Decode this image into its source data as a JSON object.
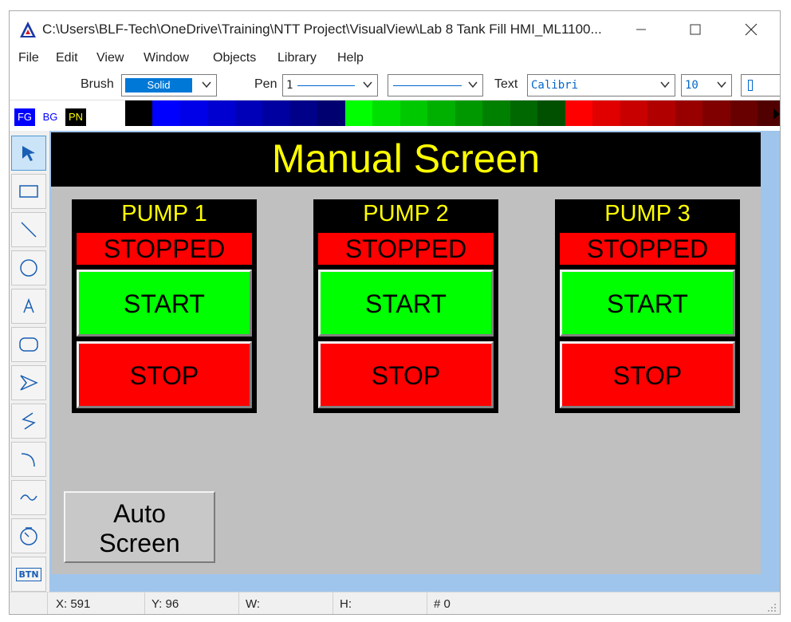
{
  "window": {
    "title": "C:\\Users\\BLF-Tech\\OneDrive\\Training\\NTT Project\\VisualView\\Lab 8 Tank Fill HMI_ML1100...",
    "minimize_icon": "minimize-icon",
    "maximize_icon": "maximize-icon",
    "close_icon": "close-icon"
  },
  "menu": [
    "File",
    "Edit",
    "View",
    "Window",
    "Objects",
    "Library",
    "Help"
  ],
  "toolbar": {
    "brush_label": "Brush",
    "brush_value": "Solid",
    "pen_label": "Pen",
    "pen_value": "1",
    "text_label": "Text",
    "font_value": "Calibri",
    "size_value": "10"
  },
  "palette": {
    "fg": "FG",
    "bg": "BG",
    "pn": "PN",
    "colors": [
      "#ffffff",
      "#000000",
      "#0000ff",
      "#0000e8",
      "#0000d0",
      "#0000b8",
      "#0000a0",
      "#000088",
      "#000070",
      "#00ff00",
      "#00e000",
      "#00c800",
      "#00b000",
      "#009800",
      "#008000",
      "#006800",
      "#005000",
      "#ff0000",
      "#e00000",
      "#c80000",
      "#b00000",
      "#980000",
      "#800000",
      "#680000",
      "#500000"
    ]
  },
  "tools": [
    "pointer-icon",
    "rectangle-icon",
    "line-icon",
    "circle-icon",
    "text-tool-icon",
    "rounded-rect-icon",
    "polygon-icon",
    "polyline-icon",
    "arc-icon",
    "wave-icon",
    "gauge-icon",
    "button-tool-icon"
  ],
  "tool_btn_label": "BTN",
  "screen": {
    "title": "Manual Screen",
    "pumps": [
      {
        "name": "PUMP 1",
        "status": "STOPPED",
        "start": "START",
        "stop": "STOP"
      },
      {
        "name": "PUMP 2",
        "status": "STOPPED",
        "start": "START",
        "stop": "STOP"
      },
      {
        "name": "PUMP 3",
        "status": "STOPPED",
        "start": "START",
        "stop": "STOP"
      }
    ],
    "auto_button_line1": "Auto",
    "auto_button_line2": "Screen"
  },
  "statusbar": {
    "x": "X:  591",
    "y": "Y:  96",
    "w": "W:",
    "h": "H:",
    "count": "#   0"
  },
  "colors": {
    "header_bg": "#000000",
    "header_text": "#ffff00",
    "start_green": "#00ff00",
    "stop_red": "#ff0000",
    "canvas_gray": "#c0c0c0"
  }
}
